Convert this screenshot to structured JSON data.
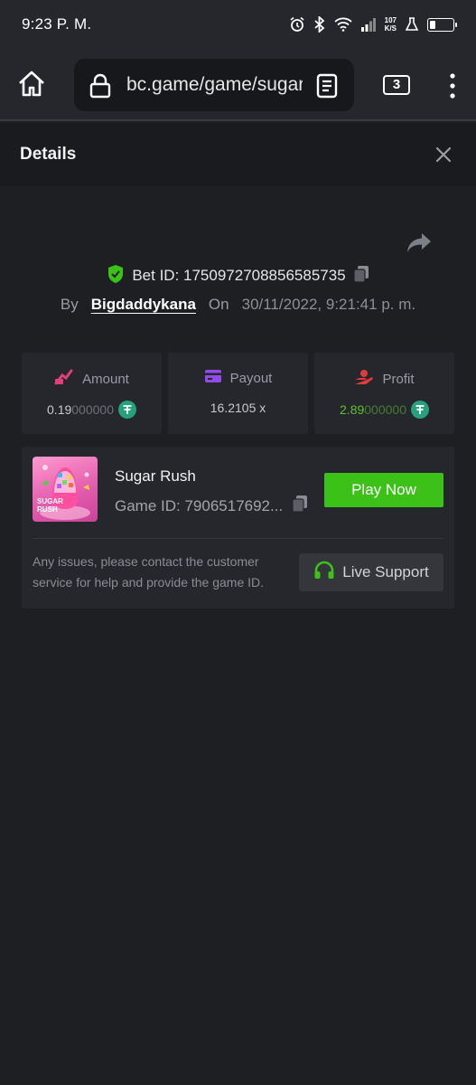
{
  "status_bar": {
    "time": "9:23 P. M.",
    "net_speed_value": "107",
    "net_speed_unit": "K/S"
  },
  "browser": {
    "url": "bc.game/game/sugar-rush",
    "tab_count": "3"
  },
  "details": {
    "title": "Details",
    "bet_id_label": "Bet ID: 1750972708856585735",
    "by_label": "By",
    "username": "Bigdaddykana",
    "on_label": "On",
    "date": "30/11/2022, 9:21:41 p. m."
  },
  "stats": {
    "amount": {
      "label": "Amount",
      "value_main": "0.19",
      "value_dim": "000000"
    },
    "payout": {
      "label": "Payout",
      "value": "16.2105 x"
    },
    "profit": {
      "label": "Profit",
      "value_main": "2.89",
      "value_dim": "000000"
    }
  },
  "game": {
    "name": "Sugar Rush",
    "game_id": "Game ID: 7906517692...",
    "thumb_text_1": "SUGAR",
    "thumb_text_2": "RUSH",
    "play_label": "Play Now",
    "issue_text": "Any issues, please contact the customer service for help and provide the game ID.",
    "support_label": "Live Support"
  },
  "colors": {
    "accent_green": "#3bc117",
    "profit_green": "#5dc133",
    "tether_green": "#26a17b",
    "amount_icon": "#e0407a",
    "payout_icon": "#8f4ce6",
    "profit_icon": "#e03a3a",
    "shield_green": "#3bc117"
  }
}
